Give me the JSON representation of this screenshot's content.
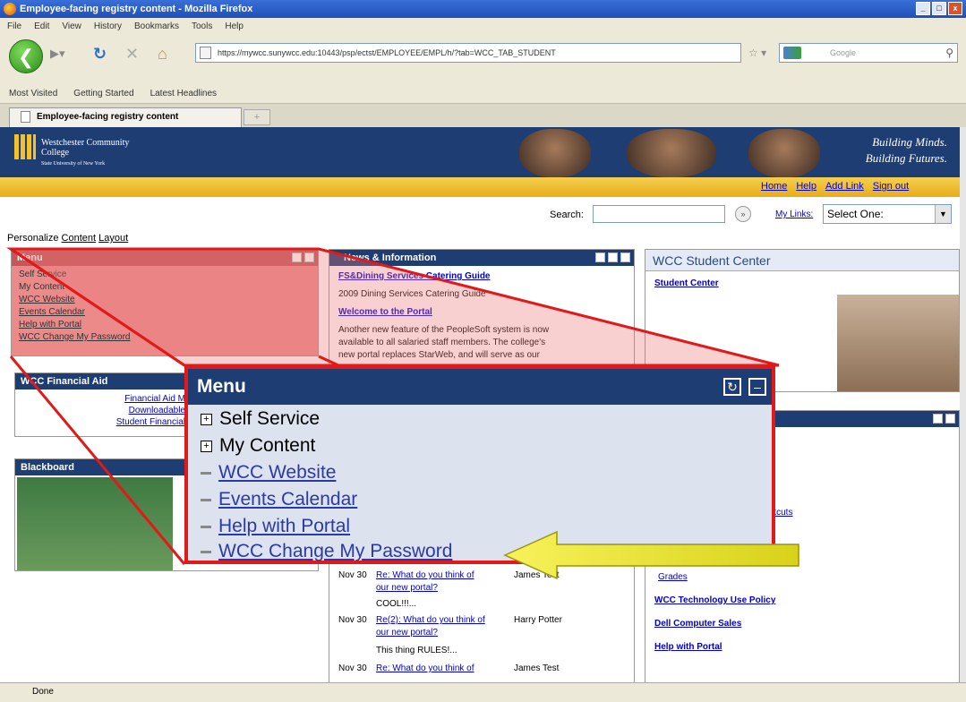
{
  "window": {
    "title": "Employee-facing registry content - Mozilla Firefox",
    "controls": [
      "_",
      "□",
      "x"
    ]
  },
  "menubar": [
    "File",
    "Edit",
    "View",
    "History",
    "Bookmarks",
    "Tools",
    "Help"
  ],
  "url": "https://mywcc.sunywcc.edu:10443/psp/ectst/EMPLOYEE/EMPL/h/?tab=WCC_TAB_STUDENT",
  "search_engine_placeholder": "Google",
  "bookmarks": [
    "Most Visited",
    "Getting Started",
    "Latest Headlines"
  ],
  "tab_title": "Employee-facing registry content",
  "banner": {
    "college": "Westchester Community College",
    "subtitle": "State University of New York",
    "slogan_1": "Building Minds.",
    "slogan_2": "Building Futures."
  },
  "top_links": [
    "Home",
    "Help",
    "Add Link",
    "Sign out"
  ],
  "search_label": "Search:",
  "mylinks_label": "My Links:",
  "mylinks_value": "Select One:",
  "personalize": {
    "label": "Personalize",
    "content": "Content",
    "layout": "Layout"
  },
  "small_menu": {
    "title": "Menu",
    "items": [
      "Self Service",
      "My Content",
      "WCC Website",
      "Events Calendar",
      "Help with Portal",
      "WCC Change My Password"
    ]
  },
  "news": {
    "title": "News & Information",
    "link1": "FS&Dining Services Catering Guide",
    "text1": "2009 Dining Services Catering Guide",
    "link2": "Welcome to the Portal",
    "body": [
      "Another new feature of the PeopleSoft system is now",
      "available to all salaried staff members. The college's",
      "new portal replaces StarWeb, and will serve as our"
    ],
    "posts": [
      {
        "date": "Nov 30",
        "link": "Re: What do you think of",
        "link2": "our new portal?",
        "author": "James Test",
        "snippet": "COOL!!!..."
      },
      {
        "date": "Nov 30",
        "link": "Re(2): What do you think of",
        "link2": "our new portal?",
        "author": "Harry Potter",
        "snippet": "This thing RULES!..."
      },
      {
        "date": "Nov 30",
        "link": "Re: What do you think of",
        "link2": "",
        "author": "James Test",
        "snippet": ""
      }
    ]
  },
  "student_center": {
    "title": "WCC Student Center",
    "link": "Student Center"
  },
  "right_links": {
    "partial": "rtcuts",
    "grades": "Grades",
    "policy": "WCC Technology Use Policy",
    "dell": "Dell Computer Sales",
    "help": "Help with Portal"
  },
  "finaid": {
    "title": "WCC Financial Aid",
    "lines": [
      "Financial Aid M",
      "Downloadable",
      "Student Financial"
    ]
  },
  "blackboard": {
    "title": "Blackboard"
  },
  "zoom_menu": {
    "title": "Menu",
    "items": [
      "Self Service",
      "My Content",
      "WCC Website",
      "Events Calendar",
      "Help with Portal",
      "WCC Change My Password"
    ]
  },
  "status": "Done",
  "colors": {
    "banner": "#1e3d72",
    "gold": "#f2c12e",
    "highlight": "#e31919",
    "arrow": "#f3ee3a"
  }
}
